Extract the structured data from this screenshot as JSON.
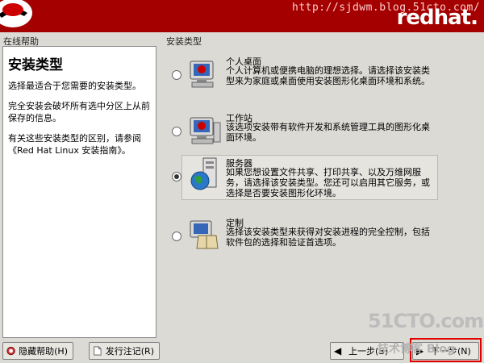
{
  "banner": {
    "watermark_url": "http://sjdwm.blog.51cto.com/",
    "logo": "redhat."
  },
  "help": {
    "section_label": "在线帮助",
    "title": "安装类型",
    "paragraphs": [
      "选择最适合于您需要的安装类型。",
      "完全安装会破坏所有选中分区上从前保存的信息。",
      "有关这些安装类型的区别，请参阅《Red Hat Linux 安装指南》。"
    ]
  },
  "install_types": {
    "section_label": "安装类型",
    "options": [
      {
        "title": "个人桌面",
        "description": "个人计算机或便携电脑的理想选择。请选择该安装类型来为家庭或桌面使用安装图形化桌面环境和系统。",
        "selected": false,
        "icon": "desktop-monitor-icon"
      },
      {
        "title": "工作站",
        "description": "该选项安装带有软件开发和系统管理工具的图形化桌面环境。",
        "selected": false,
        "icon": "workstation-monitor-icon"
      },
      {
        "title": "服务器",
        "description": "如果您想设置文件共享、打印共享、以及万维网服务，请选择该安装类型。您还可以启用其它服务，或选择是否要安装图形化环境。",
        "selected": true,
        "icon": "server-globe-icon"
      },
      {
        "title": "定制",
        "description": "选择该安装类型来获得对安装进程的完全控制，包括软件包的选择和验证首选项。",
        "selected": false,
        "icon": "custom-package-icon"
      }
    ]
  },
  "buttons": {
    "hide_help": "隐藏帮助(H)",
    "release_notes": "发行注记(R)",
    "back": "上一步(B)",
    "next": "下一步(N)"
  },
  "watermark": {
    "site": "51CTO.com",
    "blog": "技术博客 Blog"
  },
  "colors": {
    "banner": "#a40000",
    "window_bg": "#dcdad5",
    "highlight": "#e00000"
  }
}
